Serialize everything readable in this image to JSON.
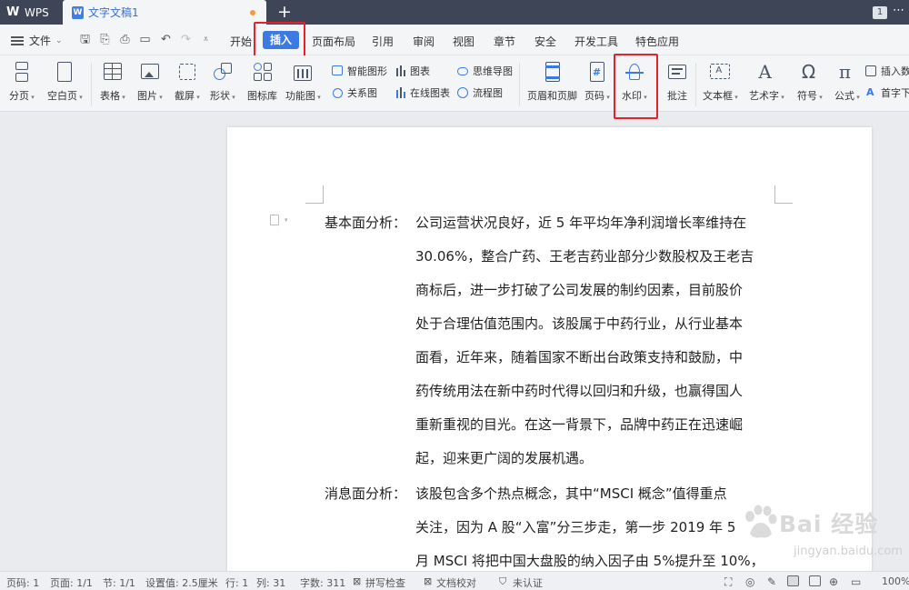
{
  "titlebar": {
    "app_label": "WPS",
    "doc_tab_label": "文字文稿1",
    "new_tab_symbol": "+",
    "window_badge": "1"
  },
  "menubar": {
    "file_label": "文件",
    "items": [
      "开始",
      "插入",
      "页面布局",
      "引用",
      "审阅",
      "视图",
      "章节",
      "安全",
      "开发工具",
      "特色应用"
    ],
    "active": "插入"
  },
  "ribbon": {
    "buttons": {
      "page_break": "分页",
      "blank_page": "空白页",
      "table": "表格",
      "picture": "图片",
      "screenshot": "截屏",
      "shape": "形状",
      "icon_library": "图标库",
      "function_chart": "功能图",
      "header_footer": "页眉和页脚",
      "page_number": "页码",
      "watermark": "水印",
      "comment": "批注",
      "text_box": "文本框",
      "word_art": "艺术字",
      "symbol": "符号",
      "formula": "公式"
    },
    "small": {
      "smart_shape": "智能图形",
      "chart": "图表",
      "mind_map": "思维导图",
      "relation_chart": "关系图",
      "online_chart": "在线图表",
      "flow_chart": "流程图",
      "insert_number": "插入数",
      "drop_cap": "首字下"
    }
  },
  "document": {
    "label1": "基本面分析：",
    "lines1": [
      "公司运营状况良好，近 5 年平均年净利润增长率维持在",
      "30.06%，整合广药、王老吉药业部分少数股权及王老吉",
      "商标后，进一步打破了公司发展的制约因素，目前股价",
      "处于合理估值范围内。该股属于中药行业，从行业基本",
      "面看，近年来，随着国家不断出台政策支持和鼓励，中",
      "药传统用法在新中药时代得以回归和升级，也赢得国人",
      "重新重视的目光。在这一背景下，品牌中药正在迅速崛",
      "起，迎来更广阔的发展机遇。"
    ],
    "label2": "消息面分析：",
    "lines2": [
      "该股包含多个热点概念，其中“MSCI 概念”值得重点",
      "关注，因为 A 股“入富”分三步走，第一步 2019 年 5",
      "月 MSCI 将把中国大盘股的纳入因子由 5%提升至 10%，"
    ]
  },
  "watermark": {
    "text": "Bai 经验",
    "url": "jingyan.baidu.com"
  },
  "statusbar": {
    "page_num": "页码: 1",
    "pages": "页面: 1/1",
    "section": "节: 1/1",
    "setting": "设置值: 2.5厘米",
    "row": "行: 1",
    "col": "列: 31",
    "word_count": "字数: 311",
    "spell_check": "拼写检查",
    "doc_proof": "文档校对",
    "auth": "未认证",
    "zoom": "100%"
  },
  "colors": {
    "accent": "#3b7ae0",
    "highlight_box": "#e8202a",
    "titlebar_bg": "#3d4556"
  }
}
